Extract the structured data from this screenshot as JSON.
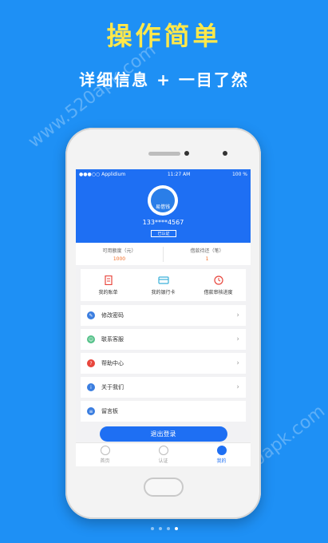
{
  "promo": {
    "title": "操作简单",
    "subtitle": "详细信息 + 一目了然",
    "watermark": "www.520apk.com"
  },
  "status_bar": {
    "carrier": "●●●○○ Applidium",
    "time": "11:27 AM",
    "battery": "100 %"
  },
  "profile": {
    "avatar_label": "易借钱",
    "phone": "133****4567",
    "verify_badge": "已认证"
  },
  "stats": [
    {
      "label": "可用额度（元）",
      "value": "1000"
    },
    {
      "label": "借款待还（笔）",
      "value": "1"
    }
  ],
  "quick_actions": [
    {
      "label": "我的账单",
      "icon": "bill-icon"
    },
    {
      "label": "我的银行卡",
      "icon": "bank-card-icon"
    },
    {
      "label": "借款审核进度",
      "icon": "progress-clock-icon"
    }
  ],
  "menu": [
    {
      "label": "修改密码",
      "icon": "pencil-icon",
      "color": "#3b7ee0"
    },
    {
      "label": "联系客服",
      "icon": "headset-icon",
      "color": "#56c28a"
    },
    {
      "label": "帮助中心",
      "icon": "help-icon",
      "color": "#e8453c"
    },
    {
      "label": "关于我们",
      "icon": "info-icon",
      "color": "#3b7ee0"
    },
    {
      "label": "留言板",
      "icon": "message-icon",
      "color": "#3b7ee0"
    }
  ],
  "logout_label": "退出登录",
  "tabs": [
    {
      "label": "首页",
      "icon": "home-icon"
    },
    {
      "label": "认证",
      "icon": "verify-icon"
    },
    {
      "label": "我的",
      "icon": "profile-icon"
    }
  ],
  "colors": {
    "background": "#1e90f5",
    "title_yellow": "#ffe84a",
    "app_blue": "#1e6ff3",
    "amount_orange": "#f26b22"
  }
}
